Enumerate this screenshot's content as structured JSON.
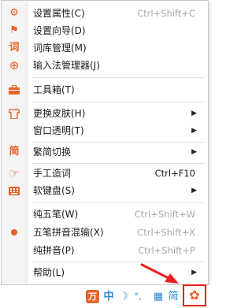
{
  "menu": {
    "items": [
      {
        "icon": "gear-icon",
        "glyph": "⚙",
        "label": "设置属性(C)",
        "shortcut": "Ctrl+Shift+C"
      },
      {
        "icon": "flag-icon",
        "glyph": "⚑",
        "label": "设置向导(D)"
      },
      {
        "icon": "dictionary-icon",
        "glyph": "词",
        "label": "词库管理(M)"
      },
      {
        "icon": "ime-manager-icon",
        "glyph": "⊕",
        "label": "输入法管理器(J)"
      },
      {
        "icon": "toolbox-icon",
        "glyph": "▬",
        "label": "工具箱(T)"
      },
      {
        "icon": "skin-shirt-icon",
        "glyph": "⇧",
        "label": "更换皮肤(H)"
      },
      {
        "icon": "",
        "glyph": "",
        "label": "窗口透明(T)"
      },
      {
        "icon": "simplified-traditional-icon",
        "glyph": "简",
        "label": "繁简切换"
      },
      {
        "icon": "hand-pointer-icon",
        "glyph": "☞",
        "label": "手工造词",
        "shortcut": "Ctrl+F10"
      },
      {
        "icon": "soft-keyboard-icon",
        "glyph": "▦",
        "label": "软键盘(S)"
      },
      {
        "icon": "",
        "glyph": "",
        "label": "纯五笔(W)",
        "shortcut": "Ctrl+Shift+W"
      },
      {
        "icon": "selected-dot-icon",
        "glyph": "",
        "label": "五笔拼音混输(X)",
        "shortcut": "Ctrl+Shift+X"
      },
      {
        "icon": "",
        "glyph": "",
        "label": "纯拼音(P)",
        "shortcut": "Ctrl+Shift+P"
      },
      {
        "icon": "",
        "glyph": "",
        "label": "帮助(L)"
      }
    ]
  },
  "taskbar": {
    "logo": "万",
    "mode": "中",
    "width": "☽",
    "punct": "°,",
    "keyboard": "▦",
    "charset": "简",
    "settings": "✿"
  },
  "colors": {
    "accent": "#e8632a",
    "highlight_box": "#e8211c",
    "taskbar_blue": "#2c87d8"
  }
}
